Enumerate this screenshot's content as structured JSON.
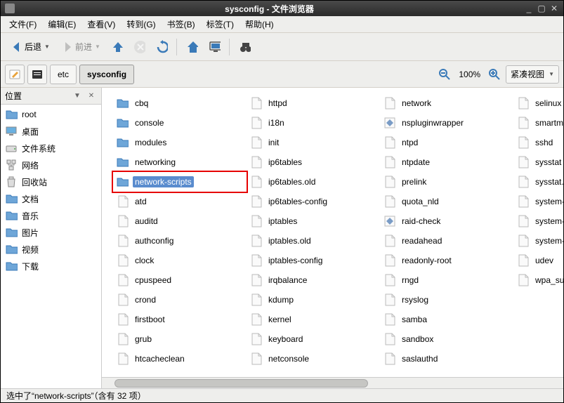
{
  "window": {
    "title": "sysconfig - 文件浏览器"
  },
  "menu": {
    "file": "文件(F)",
    "edit": "编辑(E)",
    "view": "查看(V)",
    "go": "转到(G)",
    "bookmarks": "书签(B)",
    "tabs": "标签(T)",
    "help": "帮助(H)"
  },
  "toolbar": {
    "back": "后退",
    "forward": "前进"
  },
  "path": {
    "seg1": "etc",
    "seg2": "sysconfig"
  },
  "zoom": {
    "label": "100%"
  },
  "view_mode": "紧凑视图",
  "sidebar": {
    "header": "位置",
    "items": [
      {
        "label": "root",
        "icon": "folder-blue"
      },
      {
        "label": "桌面",
        "icon": "desktop"
      },
      {
        "label": "文件系统",
        "icon": "drive"
      },
      {
        "label": "网络",
        "icon": "network"
      },
      {
        "label": "回收站",
        "icon": "trash"
      },
      {
        "label": "文档",
        "icon": "folder-blue"
      },
      {
        "label": "音乐",
        "icon": "folder-blue"
      },
      {
        "label": "图片",
        "icon": "folder-blue"
      },
      {
        "label": "视频",
        "icon": "folder-blue"
      },
      {
        "label": "下载",
        "icon": "folder-blue"
      }
    ]
  },
  "files": [
    {
      "name": "cbq",
      "type": "folder"
    },
    {
      "name": "console",
      "type": "folder"
    },
    {
      "name": "modules",
      "type": "folder"
    },
    {
      "name": "networking",
      "type": "folder"
    },
    {
      "name": "network-scripts",
      "type": "folder",
      "selected": true,
      "highlighted": true
    },
    {
      "name": "atd",
      "type": "file"
    },
    {
      "name": "auditd",
      "type": "file"
    },
    {
      "name": "authconfig",
      "type": "file"
    },
    {
      "name": "clock",
      "type": "file"
    },
    {
      "name": "cpuspeed",
      "type": "file"
    },
    {
      "name": "crond",
      "type": "file"
    },
    {
      "name": "firstboot",
      "type": "file"
    },
    {
      "name": "grub",
      "type": "file"
    },
    {
      "name": "htcacheclean",
      "type": "file"
    },
    {
      "name": "httpd",
      "type": "file"
    },
    {
      "name": "i18n",
      "type": "file"
    },
    {
      "name": "init",
      "type": "file"
    },
    {
      "name": "ip6tables",
      "type": "file"
    },
    {
      "name": "ip6tables.old",
      "type": "file"
    },
    {
      "name": "ip6tables-config",
      "type": "file"
    },
    {
      "name": "iptables",
      "type": "file"
    },
    {
      "name": "iptables.old",
      "type": "file"
    },
    {
      "name": "iptables-config",
      "type": "file"
    },
    {
      "name": "irqbalance",
      "type": "file"
    },
    {
      "name": "kdump",
      "type": "file"
    },
    {
      "name": "kernel",
      "type": "file"
    },
    {
      "name": "keyboard",
      "type": "file"
    },
    {
      "name": "netconsole",
      "type": "file"
    },
    {
      "name": "network",
      "type": "file"
    },
    {
      "name": "nspluginwrapper",
      "type": "exec"
    },
    {
      "name": "ntpd",
      "type": "file"
    },
    {
      "name": "ntpdate",
      "type": "file"
    },
    {
      "name": "prelink",
      "type": "file"
    },
    {
      "name": "quota_nld",
      "type": "file"
    },
    {
      "name": "raid-check",
      "type": "exec"
    },
    {
      "name": "readahead",
      "type": "file"
    },
    {
      "name": "readonly-root",
      "type": "file"
    },
    {
      "name": "rngd",
      "type": "file"
    },
    {
      "name": "rsyslog",
      "type": "file"
    },
    {
      "name": "samba",
      "type": "file"
    },
    {
      "name": "sandbox",
      "type": "file"
    },
    {
      "name": "saslauthd",
      "type": "file"
    },
    {
      "name": "selinux",
      "type": "file"
    },
    {
      "name": "smartmontools",
      "type": "file"
    },
    {
      "name": "sshd",
      "type": "file"
    },
    {
      "name": "sysstat",
      "type": "file"
    },
    {
      "name": "sysstat.ioconf",
      "type": "file"
    },
    {
      "name": "system-config-firewall",
      "type": "file"
    },
    {
      "name": "system-config-users",
      "type": "file"
    },
    {
      "name": "system-config-network",
      "type": "file"
    },
    {
      "name": "udev",
      "type": "file"
    },
    {
      "name": "wpa_supplicant",
      "type": "file"
    }
  ],
  "status": "选中了“network-scripts”（含有 32 项）"
}
